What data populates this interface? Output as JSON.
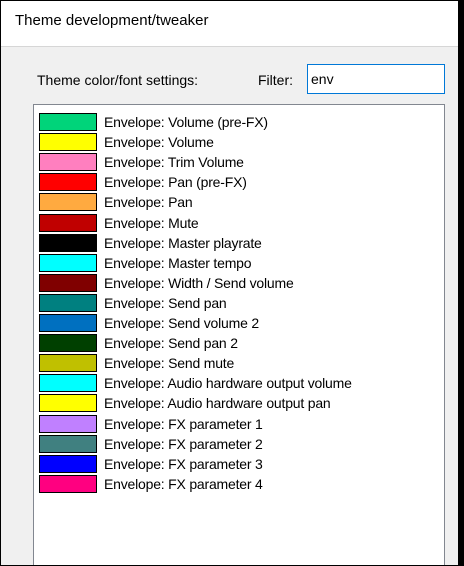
{
  "window": {
    "title": "Theme development/tweaker"
  },
  "settings": {
    "label": "Theme color/font settings:",
    "filter_label": "Filter:",
    "filter_value": "env"
  },
  "list": {
    "items": [
      {
        "label": "Envelope: Volume (pre-FX)",
        "color": "#00d47a"
      },
      {
        "label": "Envelope: Volume",
        "color": "#ffff00"
      },
      {
        "label": "Envelope: Trim Volume",
        "color": "#ff7fbf"
      },
      {
        "label": "Envelope: Pan (pre-FX)",
        "color": "#ff0000"
      },
      {
        "label": "Envelope: Pan",
        "color": "#ffaa40"
      },
      {
        "label": "Envelope: Mute",
        "color": "#c00000"
      },
      {
        "label": "Envelope: Master playrate",
        "color": "#000000"
      },
      {
        "label": "Envelope: Master tempo",
        "color": "#00ffff"
      },
      {
        "label": "Envelope: Width / Send volume",
        "color": "#800000"
      },
      {
        "label": "Envelope: Send pan",
        "color": "#008080"
      },
      {
        "label": "Envelope: Send volume 2",
        "color": "#0070c0"
      },
      {
        "label": "Envelope: Send pan 2",
        "color": "#004000"
      },
      {
        "label": "Envelope: Send mute",
        "color": "#c0c000"
      },
      {
        "label": "Envelope: Audio hardware output volume",
        "color": "#00ffff"
      },
      {
        "label": "Envelope: Audio hardware output pan",
        "color": "#ffff00"
      },
      {
        "label": "Envelope: FX parameter 1",
        "color": "#c080ff"
      },
      {
        "label": "Envelope: FX parameter 2",
        "color": "#408080"
      },
      {
        "label": "Envelope: FX parameter 3",
        "color": "#0000ff"
      },
      {
        "label": "Envelope: FX parameter 4",
        "color": "#ff0080"
      }
    ]
  }
}
